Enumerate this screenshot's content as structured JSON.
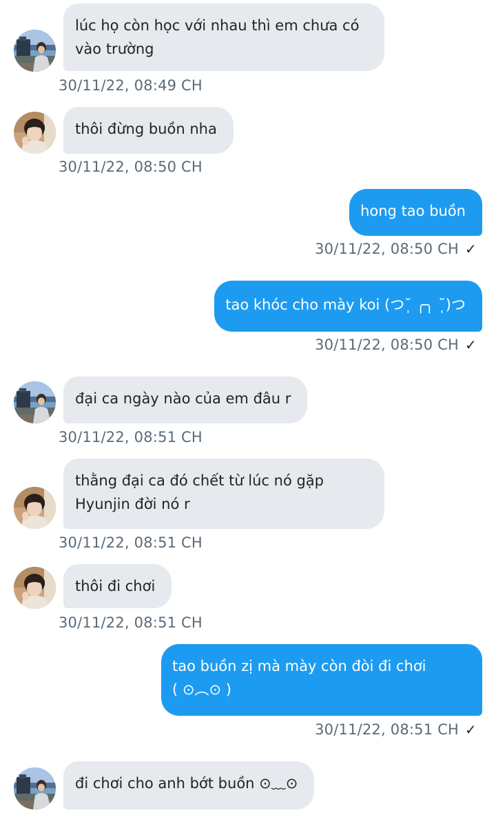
{
  "colors": {
    "incoming_bubble": "#e6e9ed",
    "outgoing_bubble": "#1d9bf0",
    "timestamp": "#5a6a78",
    "incoming_text": "#1f2326",
    "outgoing_text": "#ffffff"
  },
  "messages": [
    {
      "direction": "incoming",
      "avatar": "avatar-dock-photo",
      "text": "lúc họ còn học với nhau thì em chưa có\nvào trường",
      "time": "30/11/22,  08:49 CH"
    },
    {
      "direction": "incoming",
      "avatar": "avatar-boy-photo",
      "text": "thôi đừng buồn nha",
      "time": "30/11/22,  08:50 CH"
    },
    {
      "direction": "outgoing",
      "text": "hong tao buồn",
      "time": "30/11/22,  08:50 CH",
      "status_icon": "sent-check-icon",
      "status": "✓"
    },
    {
      "direction": "outgoing",
      "text": "tao khóc cho mày koi (つ˘̩ ╭╮ ˘̩)つ",
      "time": "30/11/22,  08:50 CH",
      "status_icon": "sent-check-icon",
      "status": "✓"
    },
    {
      "direction": "incoming",
      "avatar": "avatar-dock-photo",
      "text": "đại ca ngày nào của em đâu r",
      "time": "30/11/22,  08:51 CH"
    },
    {
      "direction": "incoming",
      "avatar": "avatar-boy-photo",
      "text": "thằng đại ca đó chết từ lúc nó gặp\nHyunjin đời nó r",
      "time": "30/11/22,  08:51 CH"
    },
    {
      "direction": "incoming",
      "avatar": "avatar-boy-photo",
      "text": "thôi đi chơi",
      "time": "30/11/22,  08:51 CH"
    },
    {
      "direction": "outgoing",
      "text": "tao buồn zị mà mày còn đòi đi chơi\n( ⊙︵⊙ )",
      "time": "30/11/22,  08:51 CH",
      "status_icon": "sent-check-icon",
      "status": "✓"
    },
    {
      "direction": "incoming",
      "avatar": "avatar-dock-photo",
      "text": "đi chơi cho anh bớt buồn ⊙﹏⊙",
      "time": ""
    }
  ]
}
